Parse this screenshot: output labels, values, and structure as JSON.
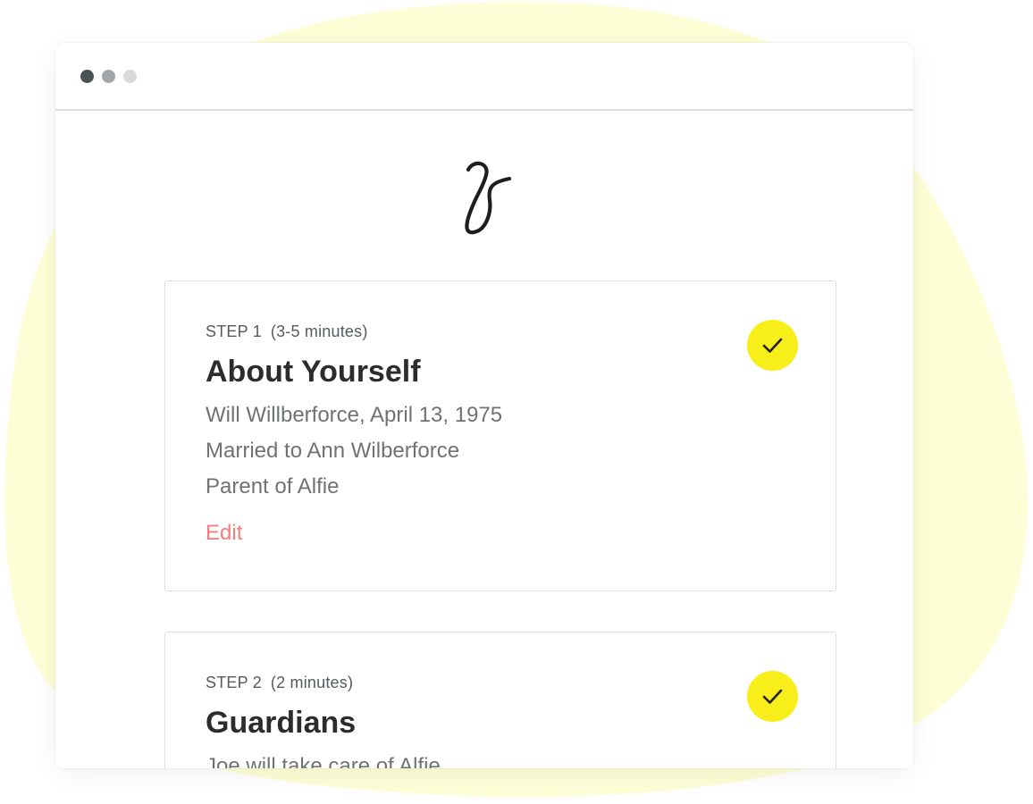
{
  "colors": {
    "background_blob": "#fdfed6",
    "accent_yellow": "#f8ee1a",
    "edit_link": "#f07f7f",
    "title_text": "#2c2c2c",
    "body_text": "#6f7275"
  },
  "window": {
    "traffic_lights": [
      "close",
      "minimize",
      "zoom"
    ]
  },
  "logo": {
    "icon": "script-g-logo-icon"
  },
  "steps": [
    {
      "step_label": "STEP 1",
      "duration": "(3-5 minutes)",
      "title": "About Yourself",
      "details": [
        "Will Willberforce, April 13, 1975",
        "Married to Ann Wilberforce",
        "Parent of Alfie"
      ],
      "edit_label": "Edit",
      "status_icon": "checkmark-icon"
    },
    {
      "step_label": "STEP 2",
      "duration": "(2 minutes)",
      "title": "Guardians",
      "details": [
        "Joe will take care of Alfie"
      ],
      "status_icon": "checkmark-icon"
    }
  ]
}
